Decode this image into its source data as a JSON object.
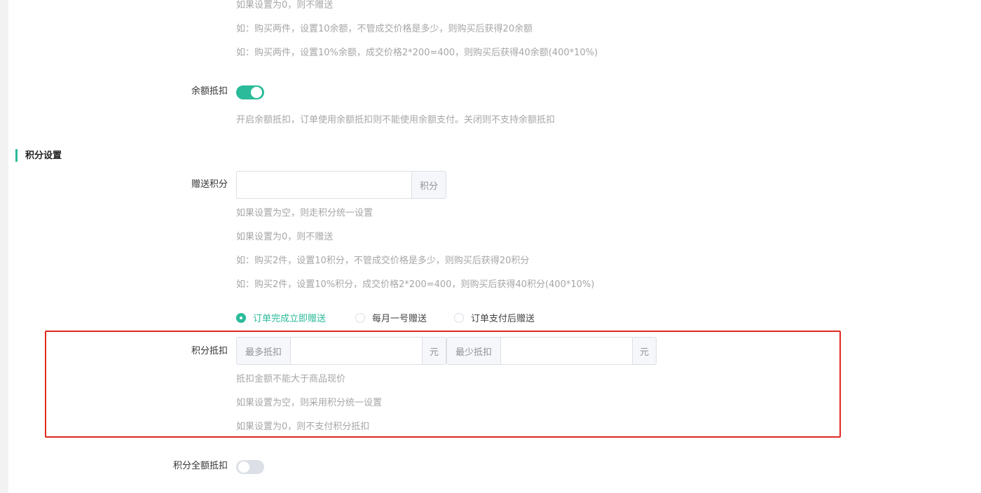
{
  "balance_hints_top": [
    "如果设置为0，则不赠送",
    "如：购买两件，设置10余额，不管成交价格是多少，则购买后获得20余额",
    "如：购买两件，设置10%余额，成交价格2*200=400，则购买后获得40余额(400*10%)"
  ],
  "balance_deduction": {
    "label": "余额抵扣",
    "enabled": true,
    "hint": "开启余额抵扣，订单使用余额抵扣则不能使用余额支付。关闭则不支持余额抵扣"
  },
  "points_section": {
    "title": "积分设置"
  },
  "gift_points": {
    "label": "赠送积分",
    "value": "",
    "suffix": "积分",
    "hints": [
      "如果设置为空，则走积分统一设置",
      "如果设置为0，则不赠送",
      "如：购买2件，设置10积分，不管成交价格是多少，则购买后获得20积分",
      "如：购买2件，设置10%积分，成交价格2*200=400，则购买后获得40积分(400*10%)"
    ],
    "timing_options": [
      {
        "label": "订单完成立即赠送",
        "checked": true
      },
      {
        "label": "每月一号赠送",
        "checked": false
      },
      {
        "label": "订单支付后赠送",
        "checked": false
      }
    ]
  },
  "points_deduction": {
    "label": "积分抵扣",
    "max_prefix": "最多抵扣",
    "max_value": "",
    "max_suffix": "元",
    "min_prefix": "最少抵扣",
    "min_value": "",
    "min_suffix": "元",
    "hints": [
      "抵扣金额不能大于商品现价",
      "如果设置为空，则采用积分统一设置",
      "如果设置为0，则不支付积分抵扣"
    ]
  },
  "points_full_deduction": {
    "label": "积分全额抵扣",
    "enabled": false
  },
  "colors": {
    "accent": "#2bbb9a",
    "highlight_border": "#e0271f"
  }
}
